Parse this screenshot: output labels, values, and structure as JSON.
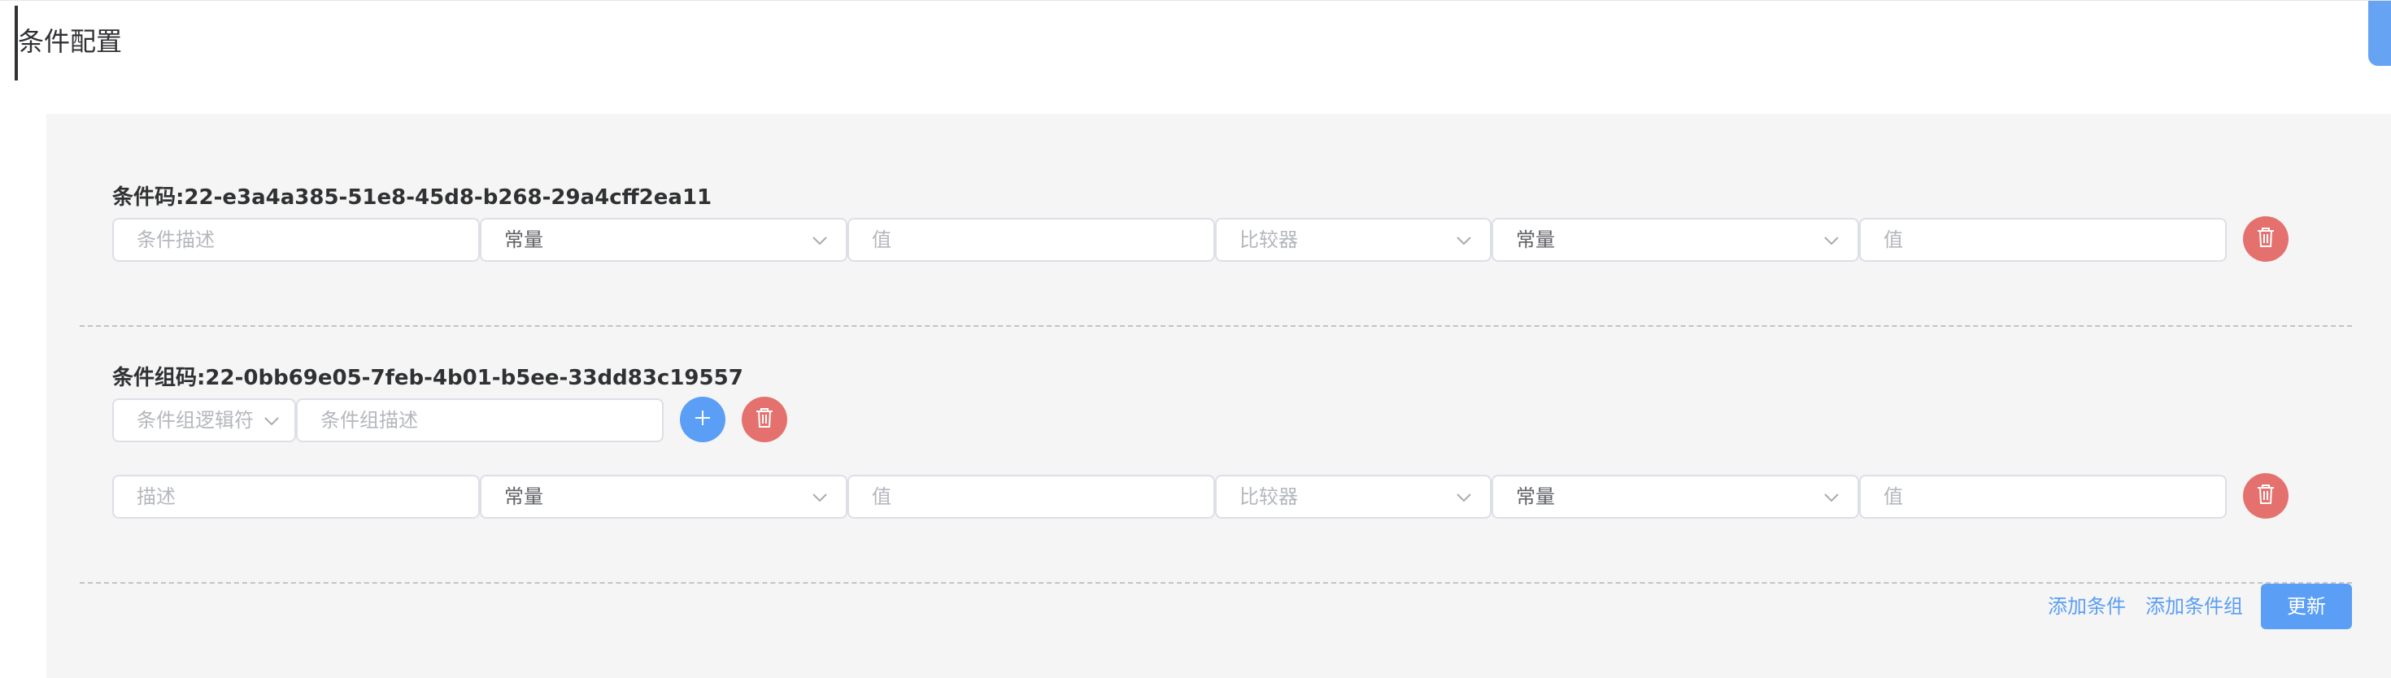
{
  "page": {
    "title": "条件配置"
  },
  "condition": {
    "code_label": "条件码:22-e3a4a385-51e8-45d8-b268-29a4cff2ea11",
    "description_placeholder": "条件描述",
    "left_type": "常量",
    "left_value_placeholder": "值",
    "comparator_placeholder": "比较器",
    "right_type": "常量",
    "right_value_placeholder": "值"
  },
  "group": {
    "code_label": "条件组码:22-0bb69e05-7feb-4b01-b5ee-33dd83c19557",
    "logic_placeholder": "条件组逻辑符",
    "description_placeholder": "条件组描述",
    "sub_condition": {
      "description_placeholder": "描述",
      "left_type": "常量",
      "left_value_placeholder": "值",
      "comparator_placeholder": "比较器",
      "right_type": "常量",
      "right_value_placeholder": "值"
    }
  },
  "footer": {
    "add_condition": "添加条件",
    "add_condition_group": "添加条件组",
    "update": "更新"
  },
  "colors": {
    "primary": "#5b9ef5",
    "danger": "#e4716d",
    "panel_bg": "#f5f5f5"
  }
}
